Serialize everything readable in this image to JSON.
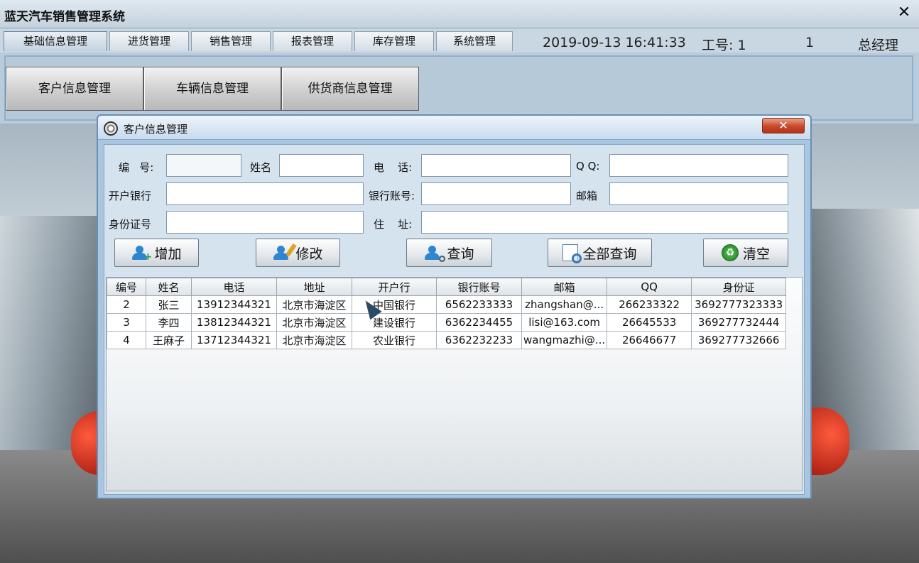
{
  "window": {
    "title": "蓝天汽车销售管理系统",
    "close_glyph": "✕"
  },
  "menu": {
    "tabs": [
      "基础信息管理",
      "进货管理",
      "销售管理",
      "报表管理",
      "库存管理",
      "系统管理"
    ],
    "datetime": "2019-09-13 16:41:33",
    "employee_label": "工号: 1",
    "employee_num": "1",
    "role": "总经理"
  },
  "ribbon": {
    "buttons": [
      "客户信息管理",
      "车辆信息管理",
      "供货商信息管理"
    ]
  },
  "dialog": {
    "title": "客户信息管理",
    "close_glyph": "✕",
    "labels": {
      "id": "编   号:",
      "name": "姓名",
      "phone": "电    话:",
      "qq": "Q Q:",
      "bank": "开户银行",
      "account": "银行账号:",
      "email": "邮箱",
      "idcard": "身份证号",
      "address": "住    址:"
    },
    "actions": {
      "add": "增加",
      "edit": "修改",
      "query": "查询",
      "query_all": "全部查询",
      "clear": "清空"
    }
  },
  "table": {
    "columns": [
      "编号",
      "姓名",
      "电话",
      "地址",
      "开户行",
      "银行账号",
      "邮箱",
      "QQ",
      "身份证"
    ],
    "rows": [
      [
        "2",
        "张三",
        "13912344321",
        "北京市海淀区",
        "中国银行",
        "6562233333",
        "zhangshan@...",
        "266233322",
        "3692777323333"
      ],
      [
        "3",
        "李四",
        "13812344321",
        "北京市海淀区",
        "建设银行",
        "6362234455",
        "lisi@163.com",
        "26645533",
        "369277732444"
      ],
      [
        "4",
        "王麻子",
        "13712344321",
        "北京市海淀区",
        "农业银行",
        "6362232233",
        "wangmazhi@...",
        "26646677",
        "369277732666"
      ]
    ]
  }
}
